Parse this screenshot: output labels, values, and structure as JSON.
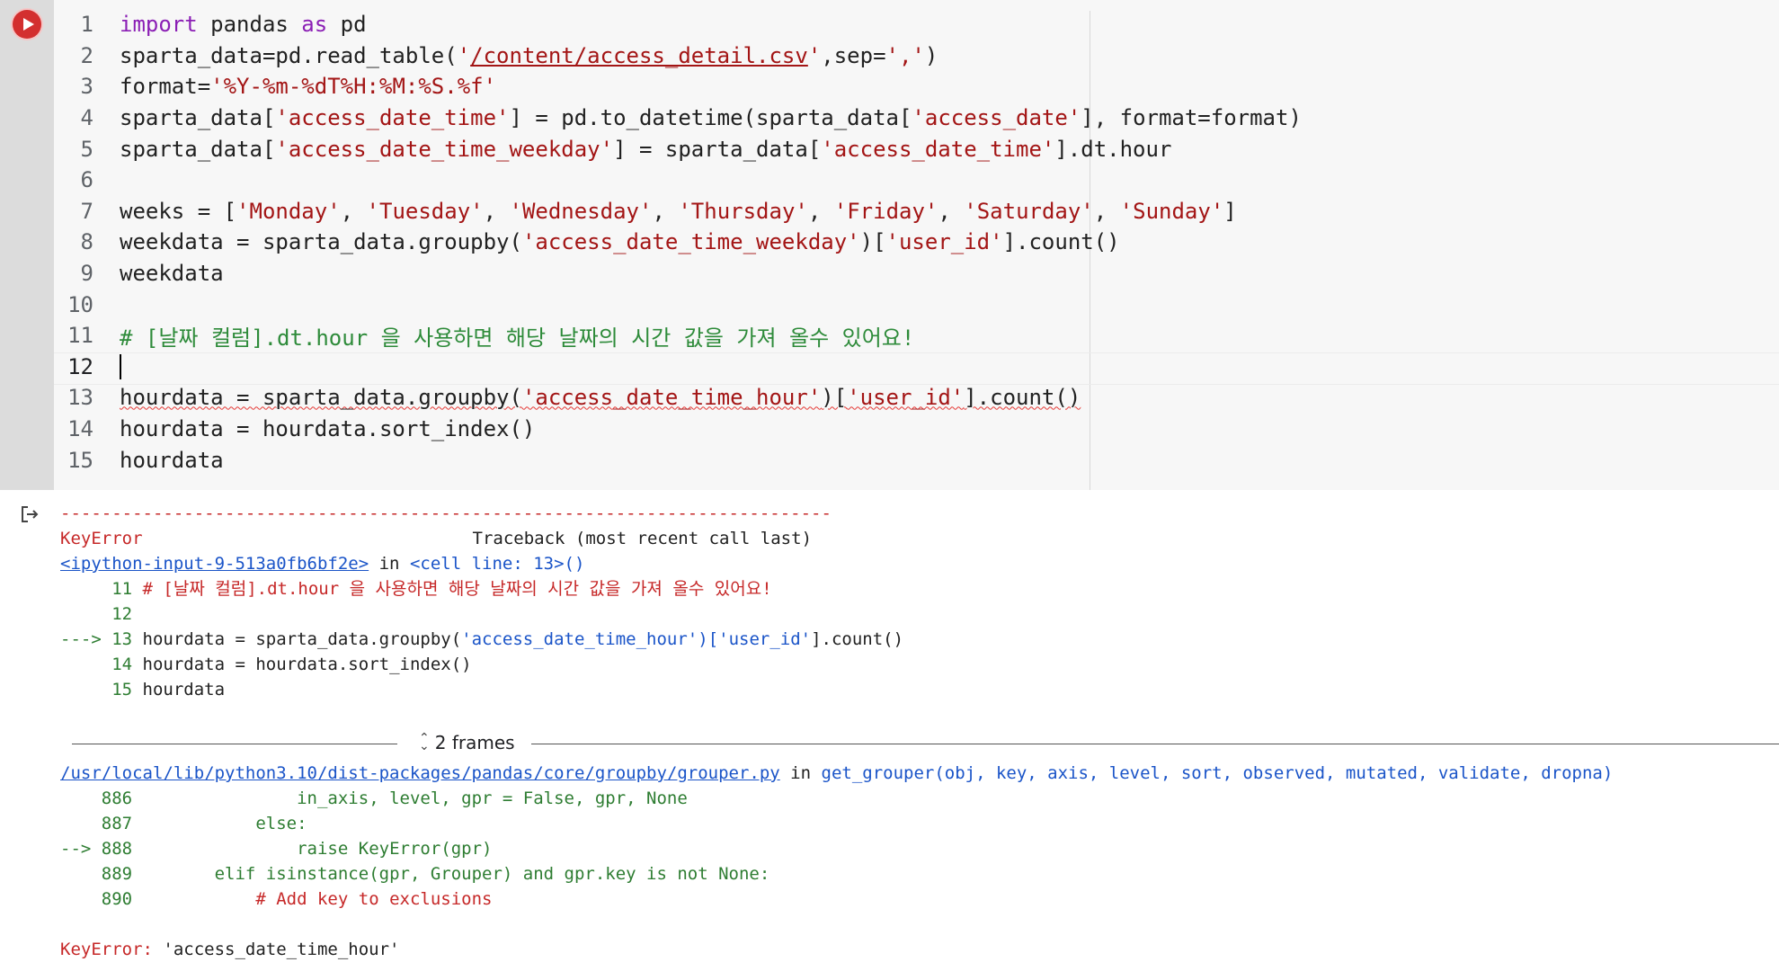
{
  "cell": {
    "run_button": "run-cell",
    "lines": [
      {
        "n": "1"
      },
      {
        "n": "2"
      },
      {
        "n": "3"
      },
      {
        "n": "4"
      },
      {
        "n": "5"
      },
      {
        "n": "6"
      },
      {
        "n": "7"
      },
      {
        "n": "8"
      },
      {
        "n": "9"
      },
      {
        "n": "10"
      },
      {
        "n": "11"
      },
      {
        "n": "12"
      },
      {
        "n": "13"
      },
      {
        "n": "14"
      },
      {
        "n": "15"
      }
    ],
    "code": {
      "l1_kw1": "import",
      "l1_a": " pandas ",
      "l1_kw2": "as",
      "l1_b": " pd",
      "l2_a": "sparta_data=pd.read_table(",
      "l2_q1": "'",
      "l2_path": "/content/access_detail.csv",
      "l2_q2": "'",
      "l2_b": ",sep=",
      "l2_s": "','",
      "l2_c": ")",
      "l3_a": "format=",
      "l3_s": "'%Y-%m-%dT%H:%M:%S.%f'",
      "l4_a": "sparta_data[",
      "l4_s1": "'access_date_time'",
      "l4_b": "] = pd.to_datetime(sparta_data[",
      "l4_s2": "'access_date'",
      "l4_c": "], format=format)",
      "l5_a": "sparta_data[",
      "l5_s1": "'access_date_time_weekday'",
      "l5_b": "] = sparta_data[",
      "l5_s2": "'access_date_time'",
      "l5_c": "].dt.hour",
      "l6": "",
      "l7_a": "weeks = [",
      "l7_s1": "'Monday'",
      "l7_s2": "'Tuesday'",
      "l7_s3": "'Wednesday'",
      "l7_s4": "'Thursday'",
      "l7_s5": "'Friday'",
      "l7_s6": "'Saturday'",
      "l7_s7": "'Sunday'",
      "l7_sep": ", ",
      "l7_end": "]",
      "l8_a": "weekdata = sparta_data.groupby(",
      "l8_s1": "'access_date_time_weekday'",
      "l8_b": ")[",
      "l8_s2": "'user_id'",
      "l8_c": "].count()",
      "l9": "weekdata",
      "l10": "",
      "l11": "# [날짜 컬럼].dt.hour 을 사용하면 해당 날짜의 시간 값을 가져 올수 있어요!",
      "l12": "",
      "l13_a": "hourdata = sparta_data.groupby(",
      "l13_s1": "'access_date_time_hour'",
      "l13_b": ")[",
      "l13_s2": "'user_id'",
      "l13_c": "].count()",
      "l14": "hourdata = hourdata.sort_index()",
      "l15": "hourdata"
    }
  },
  "output": {
    "dashes": "---------------------------------------------------------------------------",
    "error_name": "KeyError",
    "traceback_title": "Traceback (most recent call last)",
    "input_link": "<ipython-input-9-513a0fb6bf2e>",
    "in_word": " in ",
    "cell_ref": "<cell line: 13>()",
    "tb": [
      {
        "prefix": "     ",
        "n": "11",
        "text": " # [날짜 컬럼].dt.hour 을 사용하면 해당 날짜의 시간 값을 가져 올수 있어요!"
      },
      {
        "prefix": "     ",
        "n": "12",
        "text": ""
      },
      {
        "prefix": "---> ",
        "n": "13",
        "text": " hourdata = sparta_data.groupby(",
        "s1": "'access_date_time_hour'",
        "mid": ")[",
        "s2": "'user_id'",
        "end": "].count()"
      },
      {
        "prefix": "     ",
        "n": "14",
        "text": " hourdata = hourdata.sort_index()"
      },
      {
        "prefix": "     ",
        "n": "15",
        "text": " hourdata"
      }
    ],
    "frames_label": "2 frames",
    "file_link": "/usr/local/lib/python3.10/dist-packages/pandas/core/groupby/grouper.py",
    "func_sig": "get_grouper(obj, key, axis, level, sort, observed, mutated, validate, dropna)",
    "tb2": [
      {
        "prefix": "    ",
        "n": "886",
        "code": "                in_axis, level, gpr = False, gpr, None"
      },
      {
        "prefix": "    ",
        "n": "887",
        "code": "            else:"
      },
      {
        "prefix": "--> ",
        "n": "888",
        "code": "                raise KeyError(gpr)"
      },
      {
        "prefix": "    ",
        "n": "889",
        "code": "        elif isinstance(gpr, Grouper) and gpr.key is not None:"
      },
      {
        "prefix": "    ",
        "n": "890",
        "code": "            # Add key to exclusions"
      }
    ],
    "final_error_name": "KeyError:",
    "final_error_msg": " 'access_date_time_hour'"
  }
}
